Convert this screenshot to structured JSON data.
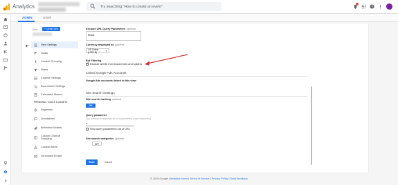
{
  "app": {
    "title": "Analytics"
  },
  "search": {
    "placeholder": "Try searching \"How to create an event\""
  },
  "notifications": {
    "count": "1"
  },
  "tabs": [
    {
      "label": "ADMIN",
      "active": true
    },
    {
      "label": "USER",
      "active": false
    }
  ],
  "view_column": {
    "label": "View",
    "create_button": "+ Create View"
  },
  "nav": {
    "items": [
      {
        "label": "View Settings",
        "icon": "document-icon",
        "active": true
      },
      {
        "label": "Goals",
        "icon": "flag-icon",
        "active": false
      },
      {
        "label": "Content Grouping",
        "icon": "person-walking-icon",
        "active": false
      },
      {
        "label": "Filters",
        "icon": "filter-icon",
        "active": false
      },
      {
        "label": "Channel Settings",
        "icon": "channel-icon",
        "active": false
      },
      {
        "label": "Ecommerce Settings",
        "icon": "cart-icon",
        "active": false
      },
      {
        "label": "Calculated Metrics",
        "icon": "calculator-icon",
        "active": false
      }
    ],
    "personal_heading": "PERSONAL TOOLS & ASSETS",
    "personal_items": [
      {
        "label": "Segments",
        "icon": "segments-icon"
      },
      {
        "label": "Annotations",
        "icon": "annotation-icon"
      },
      {
        "label": "Attribution Models",
        "icon": "attribution-icon"
      },
      {
        "label": "Custom Channel Grouping",
        "icon": "custom-channel-icon"
      },
      {
        "label": "Custom Alerts",
        "icon": "alert-icon"
      },
      {
        "label": "Scheduled Emails",
        "icon": "email-icon"
      }
    ]
  },
  "settings": {
    "exclude_params": {
      "title": "Exclude URL Query Parameters",
      "optional": "optional",
      "value": "fbclid"
    },
    "currency": {
      "title": "Currency displayed as",
      "optional": "optional",
      "value": "US Dollar (USD $)"
    },
    "bot_filtering": {
      "title": "Bot Filtering",
      "checkbox_label": "Exclude all hits from known bots and spiders",
      "checked": true
    },
    "ads_section": {
      "heading": "Linked Google Ads Accounts",
      "linked_label": "Google Ads accounts linked to this view"
    },
    "site_search": {
      "heading": "Site Search Settings",
      "tracking_title": "Site search tracking",
      "tracking_optional": "optional",
      "tracking_state": "ON",
      "query_param_title": "Query parameter",
      "query_param_hint": "Use commas to separate up to 5 parameters (case insensitive)",
      "query_param_value": "s",
      "strip_label": "Strip query parameters out of URL",
      "categories_title": "Site search categories",
      "categories_optional": "optional",
      "categories_state": "OFF"
    }
  },
  "actions": {
    "save": "Save",
    "cancel": "Cancel"
  },
  "footer": {
    "copyright": "© 2019 Google",
    "links": [
      "Analytics home",
      "Terms of Service",
      "Privacy Policy",
      "Send feedback"
    ],
    "separator": " | "
  },
  "colors": {
    "accent": "#1a73e8",
    "annotation_arrow": "#d32f2f"
  }
}
